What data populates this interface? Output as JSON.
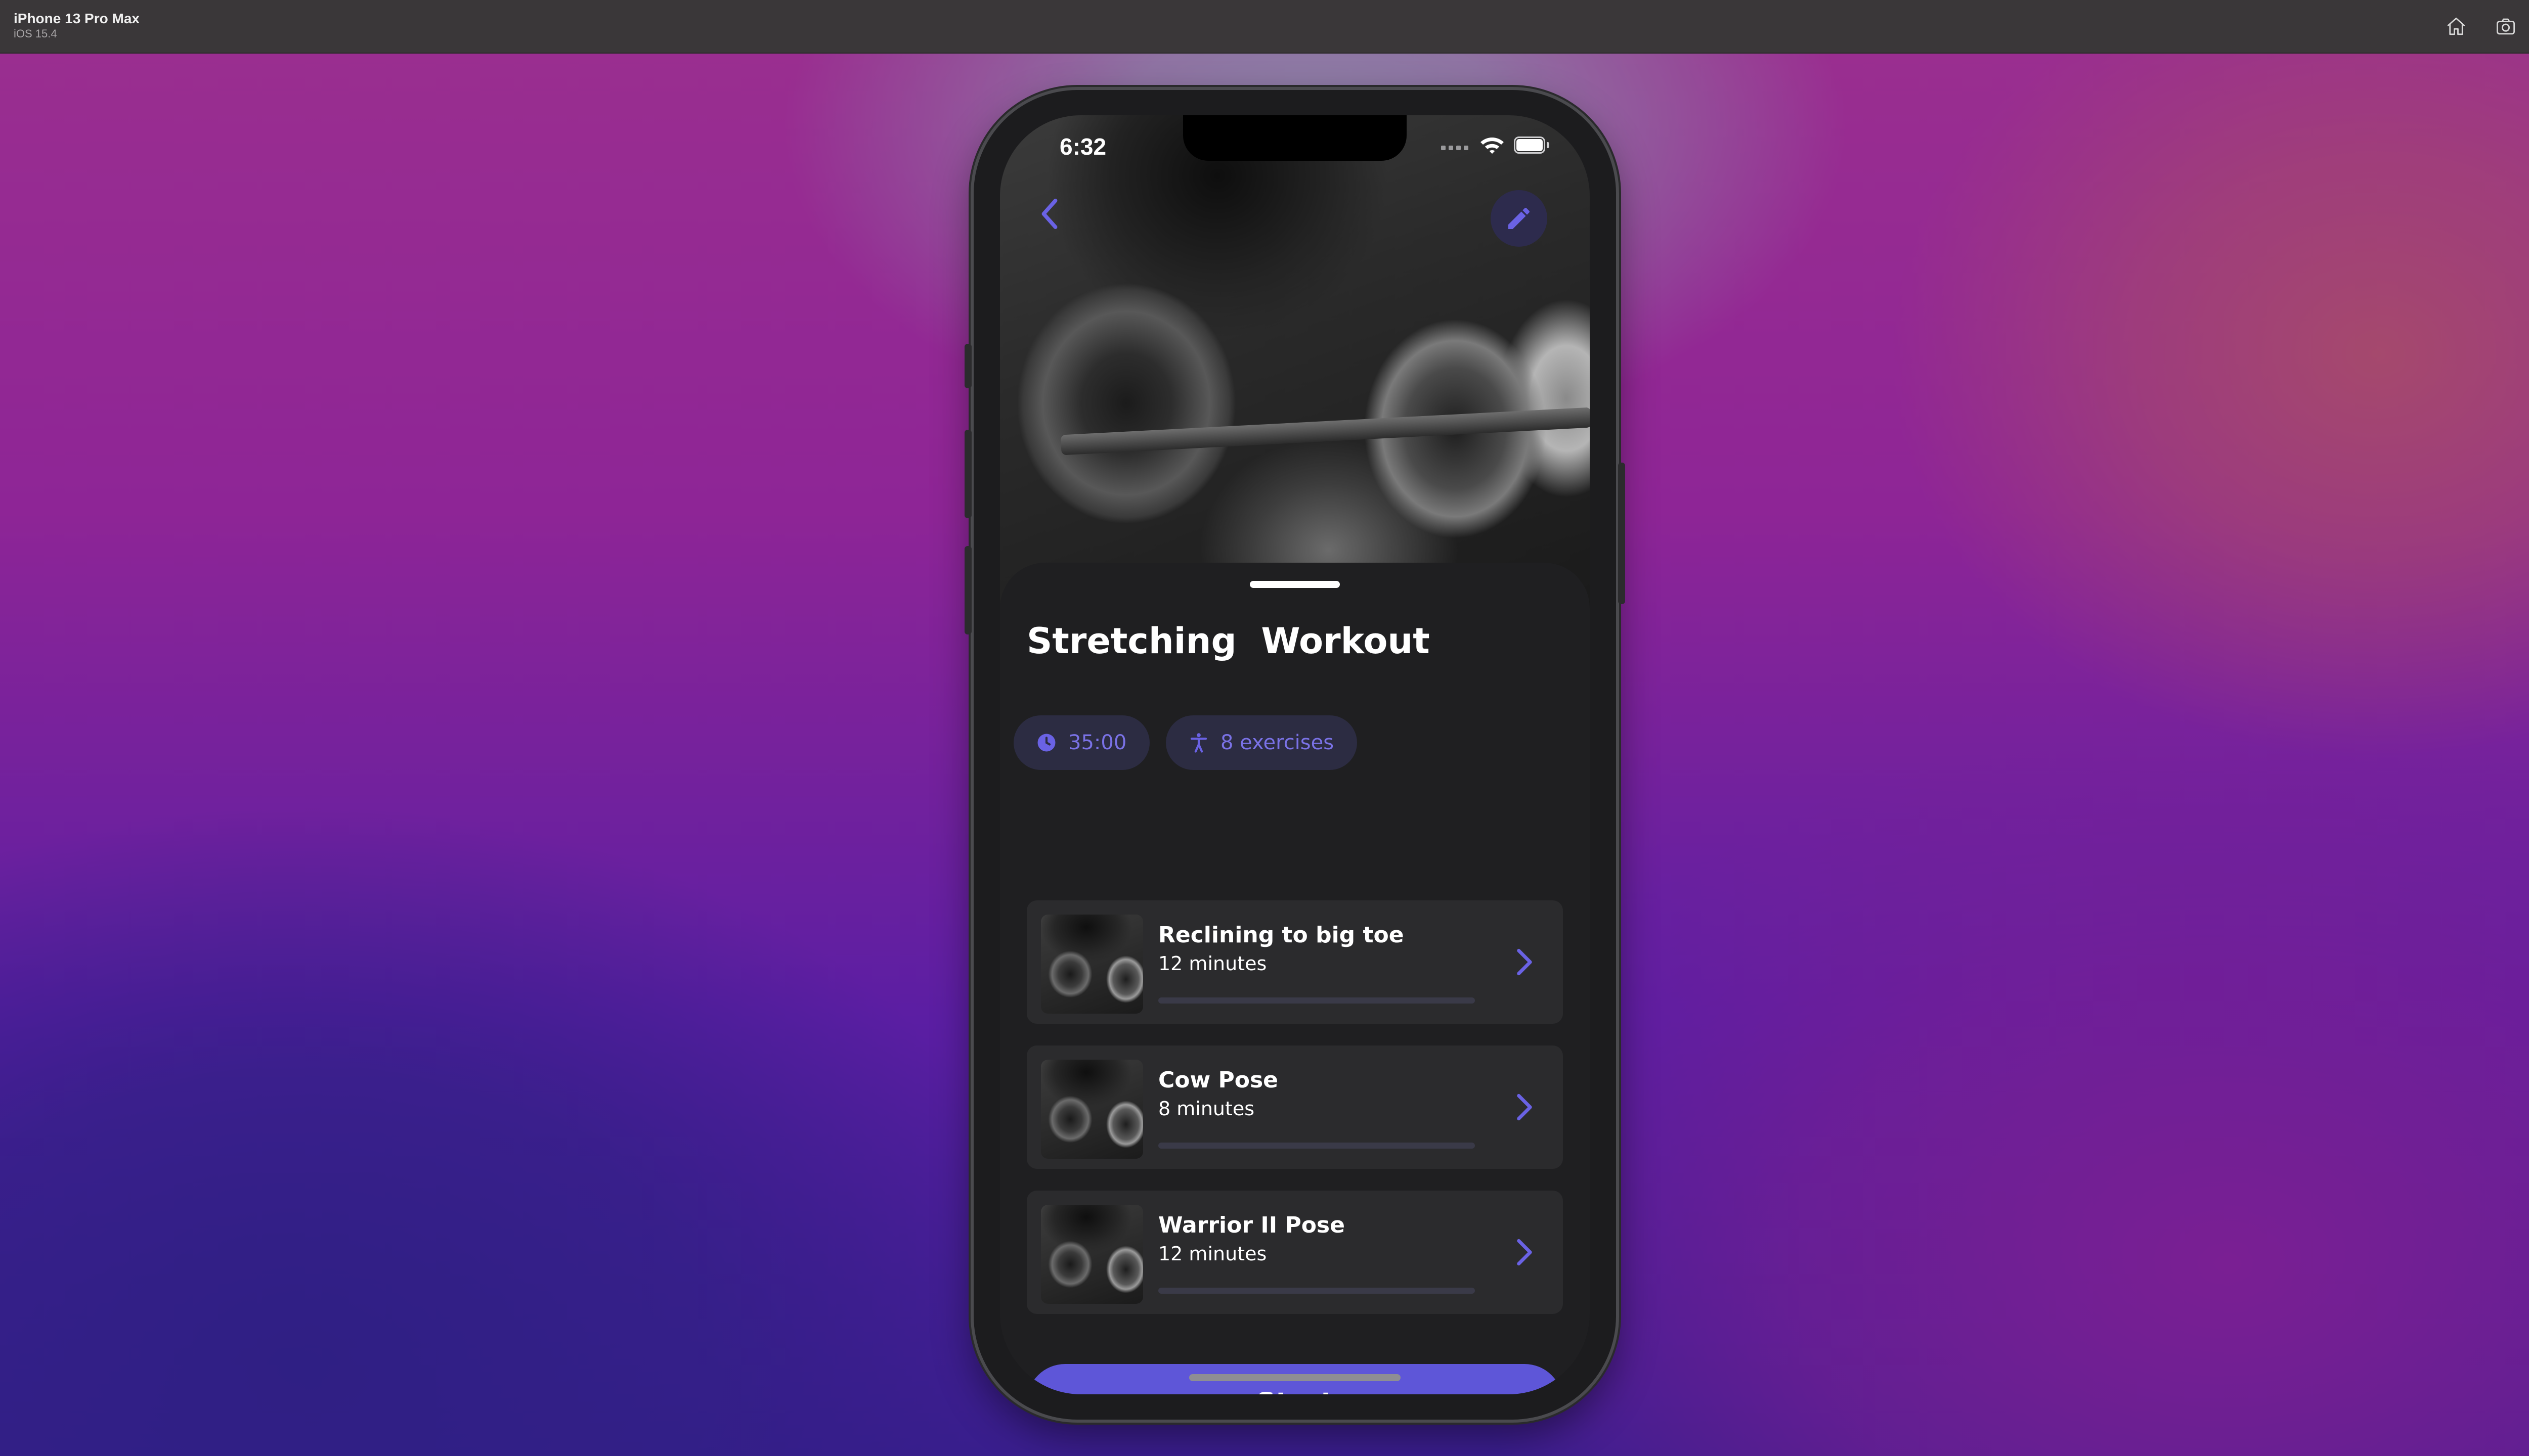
{
  "simulator": {
    "device_name": "iPhone 13 Pro Max",
    "os_version": "iOS 15.4",
    "icons": [
      "home-icon",
      "screenshot-icon",
      "rotate-icon"
    ]
  },
  "status_bar": {
    "time": "6:32"
  },
  "nav": {
    "back_icon": "chevron-left-icon",
    "edit_icon": "pencil-icon"
  },
  "workout": {
    "title": "Stretching  Workout",
    "duration": "35:00",
    "exercise_count": "8 exercises"
  },
  "exercises": [
    {
      "name": "Reclining to big toe",
      "duration": "12 minutes",
      "progress": 0
    },
    {
      "name": "Cow Pose",
      "duration": "8 minutes",
      "progress": 0
    },
    {
      "name": "Warrior II Pose",
      "duration": "12 minutes",
      "progress": 0
    }
  ],
  "start_label": "Start",
  "colors": {
    "accent": "#5e56d8",
    "chip_text": "#7a72e6",
    "chip_bg": "#2c2c42",
    "sheet_bg": "#1f1f21",
    "card_bg": "#2b2b2d"
  }
}
